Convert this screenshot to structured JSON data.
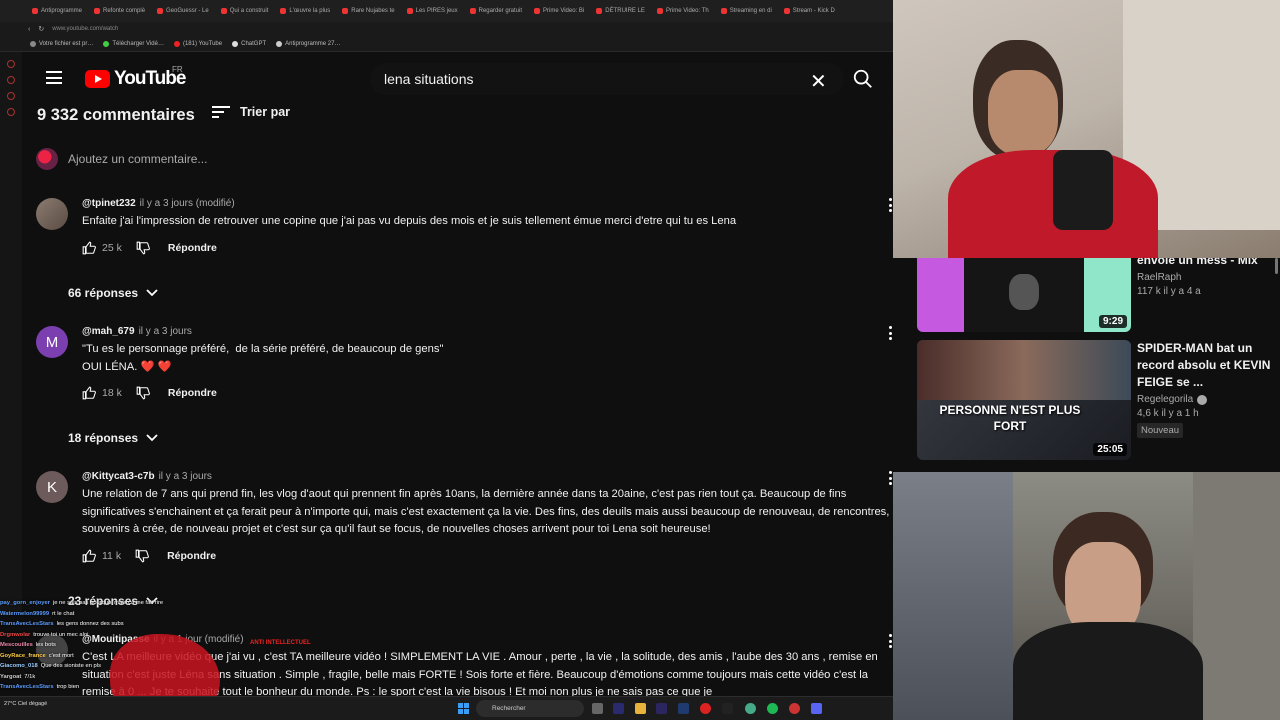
{
  "browser": {
    "tabs": [
      "Antiprogramme",
      "Refonte complè",
      "GeoGuessr - Le",
      "Qui a construit",
      "L'œuvre la plus",
      "Rare Nujabes te",
      "Les PIRES jeux",
      "Regarder gratuit",
      "Prime Video: Bi",
      "DÉTRUIRE LE",
      "Prime Video: Th",
      "Streaming en di",
      "Stream - Kick D"
    ],
    "url": "www.youtube.com/watch",
    "bookmarks": [
      "Votre fichier est pr…",
      "Télécharger Vidé…",
      "(181) YouTube",
      "ChatGPT",
      "Antiprogramme 27…"
    ]
  },
  "header": {
    "logo_text": "YouTube",
    "country": "FR",
    "search_value": "lena situations",
    "clear_glyph": "✕"
  },
  "comments_section": {
    "count_label": "9 332 commentaires",
    "sort_label": "Trier par",
    "add_placeholder": "Ajoutez un commentaire..."
  },
  "comments": [
    {
      "author": "@tpinet232",
      "time": "il y a 3 jours (modifié)",
      "text": "Enfaite j'ai l'impression de retrouver une copine que j'ai pas vu depuis des mois et je suis tellement émue merci d'etre qui tu es Lena",
      "likes": "25 k",
      "reply_label": "Répondre",
      "replies_label": "66 réponses"
    },
    {
      "author": "@mah_679",
      "avatar_letter": "M",
      "time": "il y a 3 jours",
      "text": "\"Tu es le personnage préféré,  de la série préféré, de beaucoup de gens\"\nOUI LÉNA. ❤️ ❤️",
      "likes": "18 k",
      "reply_label": "Répondre",
      "replies_label": "18 réponses"
    },
    {
      "author": "@Kittycat3-c7b",
      "avatar_letter": "K",
      "time": "il y a 3 jours",
      "text": "Une relation de 7 ans qui prend fin, les vlog d'aout qui prennent fin après 10ans, la dernière année dans ta 20aine, c'est pas rien tout ça. Beaucoup de fins significatives s'enchainent et ça ferait peur à n'importe qui, mais c'est exactement ça la vie. Des fins, des deuils mais aussi beaucoup de renouveau, de rencontres, de souvenirs à crée, de nouveau projet et c'est sur ça qu'il faut se focus, de nouvelles choses arrivent pour toi Lena soit heureuse!",
      "likes": "11 k",
      "reply_label": "Répondre",
      "replies_label": "23 réponses"
    },
    {
      "author": "@Mouitipasse",
      "time": "il y a 1 jour (modifié)",
      "text": "C'est LA meilleure vidéo que j'ai vu , c'est TA meilleure vidéo ! SIMPLEMENT LA VIE . Amour , perte , la vie , la solitude, des amis , l'aube des 30 ans , remise en situation c'est juste Léna sans situation . Simple , fragile, belle mais FORTE ! Sois forte et fière. Beaucoup d'émotions comme toujours mais cette vidéo c'est la remise à 0 ... Je te souhaite tout le bonheur du monde. Ps : le sport c'est la vie bisous ! Et moi non plus je ne sais pas ce que je"
    }
  ],
  "chat": [
    {
      "user": "pay_gorn_enjoyer",
      "msg": "je ne sais pas pourquoi mais ça me fait rire"
    },
    {
      "user": "Watermelon99999",
      "msg": "rt le chat"
    },
    {
      "user": "TransAvecLesStars",
      "msg": "les gens donnez des subs"
    },
    {
      "user": "Drgmwolar",
      "msg": "trouve toi un mec aloi"
    },
    {
      "user": "Mescouilles",
      "msg": "les bots"
    },
    {
      "user": "GoyRace_france",
      "msg": "c'est mort"
    },
    {
      "user": "Giacomo_018",
      "msg": "Que des sioniste en pls"
    },
    {
      "user": "Yargoat",
      "msg": "7/1k"
    },
    {
      "user": "TransAvecLesStars",
      "msg": "trop bien"
    }
  ],
  "overlay_text": "ANTI INTELLECTUEL",
  "taskbar": {
    "search_placeholder": "Rechercher",
    "weather": "27°C Ciel dégagé"
  },
  "sidebar": {
    "recommendations": [
      {
        "title": "envoie un mess - Mix",
        "channel": "RaelRaph",
        "meta": "117 k  il y a 4 a",
        "duration": "9:29"
      },
      {
        "title": "SPIDER-MAN bat un record absolu et KEVIN FEIGE se ...",
        "channel": "Regelegorila",
        "meta": "4,6 k  il y a 1 h",
        "duration": "25:05",
        "badge": "Nouveau",
        "thumb_text": "PERSONNE N'EST PLUS FORT"
      }
    ]
  },
  "colors": {
    "background": "#0f0f0f",
    "accent_red": "#ff0000",
    "text_primary": "#f1f1f1",
    "text_secondary": "#aaaaaa"
  }
}
